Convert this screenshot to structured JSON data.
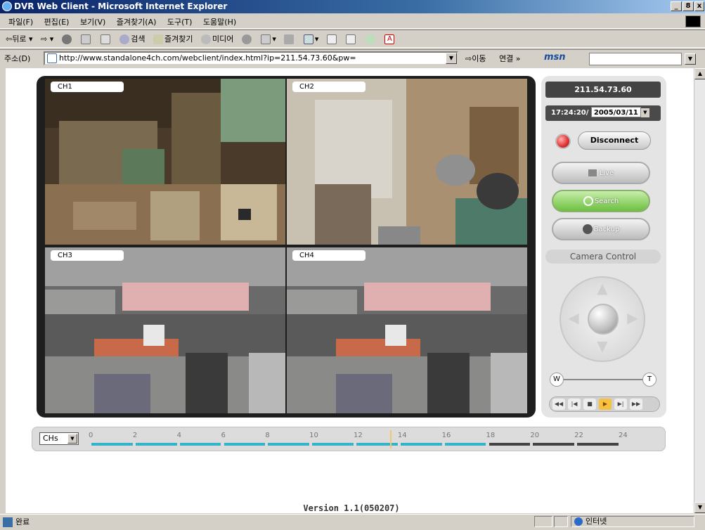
{
  "window": {
    "title": "DVR Web Client - Microsoft Internet Explorer",
    "min": "_",
    "max": "8",
    "close": "x"
  },
  "menu": [
    "파일(F)",
    "편집(E)",
    "보기(V)",
    "즐겨찾기(A)",
    "도구(T)",
    "도움말(H)"
  ],
  "toolbar": {
    "back": "뒤로",
    "search": "검색",
    "favorites": "즐겨찾기",
    "media": "미디어"
  },
  "address": {
    "label": "주소(D)",
    "url": "http://www.standalone4ch.com/webclient/index.html?ip=211.54.73.60&pw=",
    "go": "이동",
    "links": "연결 »",
    "msn": "msn"
  },
  "cameras": [
    {
      "label": "CH1"
    },
    {
      "label": "CH2"
    },
    {
      "label": "CH3"
    },
    {
      "label": "CH4"
    }
  ],
  "side": {
    "ip": "211.54.73.60",
    "time": "17:24:20/",
    "date": "2005/03/11",
    "disconnect": "Disconnect",
    "live": "Live",
    "search": "Search",
    "backup": "Backup",
    "camera_control": "Camera Control",
    "zoom_w": "W",
    "zoom_t": "T"
  },
  "timeline": {
    "selector": "CHs",
    "hours": [
      "0",
      "2",
      "4",
      "6",
      "8",
      "10",
      "12",
      "14",
      "16",
      "18",
      "20",
      "22",
      "24"
    ],
    "recorded_until_hour": 17.0,
    "current_hour": 13.6
  },
  "version": "Version 1.1(050207)",
  "status": {
    "done": "완료",
    "zone": "인터넷"
  },
  "colors": {
    "recorded": "#33b4c8",
    "unrecorded": "#444444",
    "search_active": "#8ccf5a"
  }
}
